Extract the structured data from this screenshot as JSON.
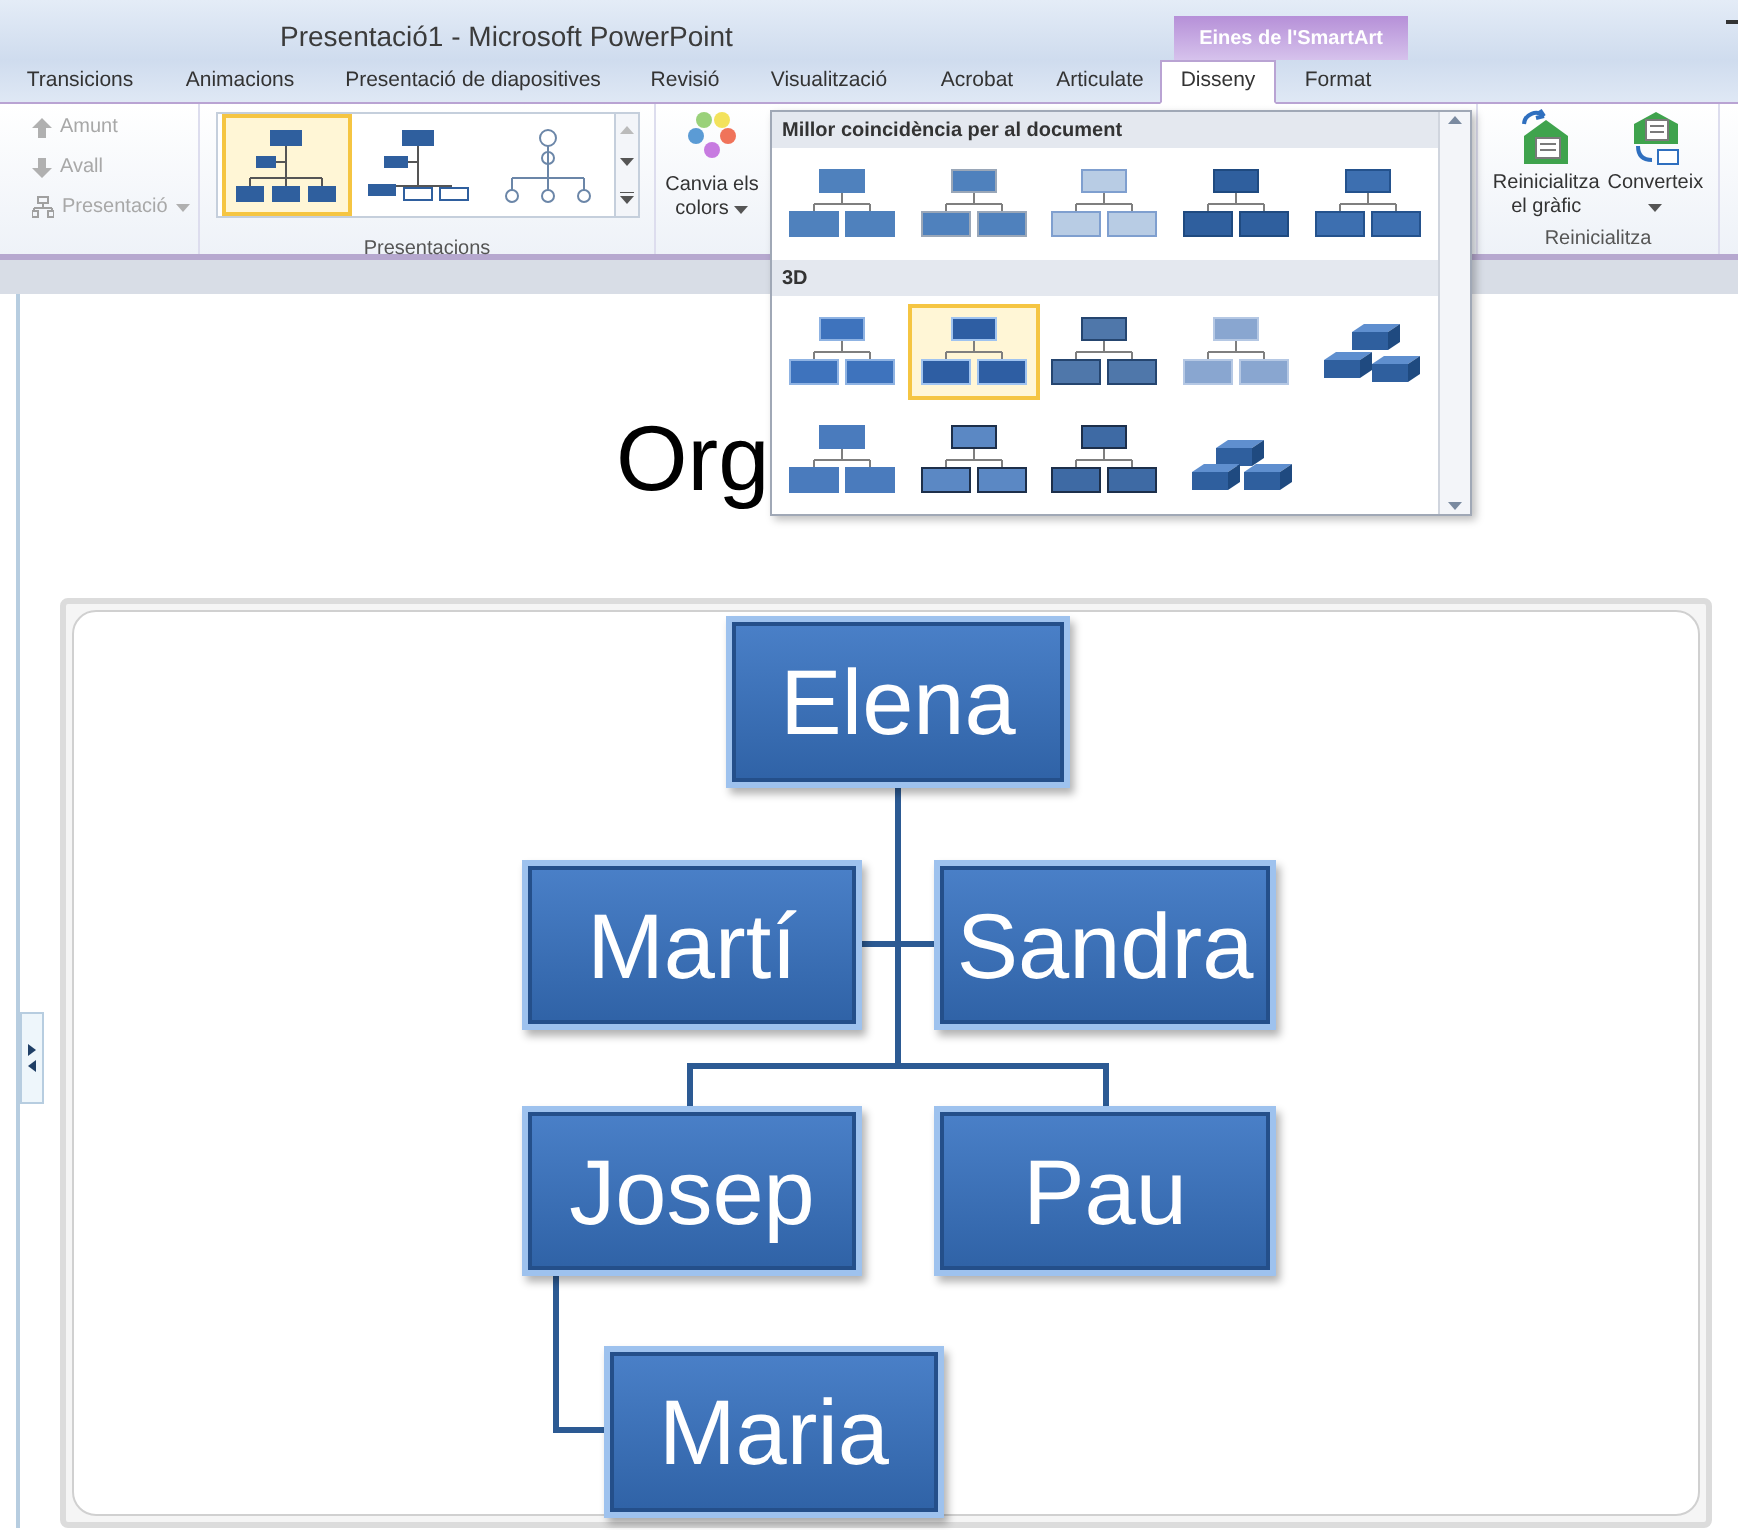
{
  "window": {
    "title": "Presentació1 - Microsoft PowerPoint",
    "context_header": "Eines de l'SmartArt"
  },
  "tabs": [
    {
      "label": "Transicions",
      "selected": false
    },
    {
      "label": "Animacions",
      "selected": false
    },
    {
      "label": "Presentació de diapositives",
      "selected": false
    },
    {
      "label": "Revisió",
      "selected": false
    },
    {
      "label": "Visualització",
      "selected": false
    },
    {
      "label": "Acrobat",
      "selected": false
    },
    {
      "label": "Articulate",
      "selected": false
    },
    {
      "label": "Disseny",
      "selected": true
    },
    {
      "label": "Format",
      "selected": false
    }
  ],
  "ribbon": {
    "shape_commands": [
      {
        "label": "Amunt",
        "disabled": true,
        "kind": "up"
      },
      {
        "label": "Avall",
        "disabled": true,
        "kind": "down"
      },
      {
        "label": "Presentació",
        "disabled": true,
        "kind": "layout"
      }
    ],
    "layouts": {
      "label": "Presentacions",
      "items": [
        {
          "kind": "org",
          "selected": true
        },
        {
          "kind": "hierarchy",
          "selected": false
        },
        {
          "kind": "circle",
          "selected": false
        }
      ]
    },
    "colors_button": {
      "line1": "Canvia els",
      "line2": "colors"
    },
    "reset_group": {
      "label": "Reinicialitza",
      "buttons": [
        {
          "line1": "Reinicialitza",
          "line2": "el gràfic",
          "kind": "reset"
        },
        {
          "line1": "Converteix",
          "kind": "convert"
        }
      ]
    }
  },
  "styles_gallery": {
    "sections": [
      {
        "heading": "Millor coincidència per al document",
        "items": [
          {
            "kind": "simple",
            "selected": false
          },
          {
            "kind": "shadow",
            "selected": false
          },
          {
            "kind": "light",
            "selected": false
          },
          {
            "kind": "dark",
            "selected": false
          },
          {
            "kind": "gradient",
            "selected": false
          }
        ]
      },
      {
        "heading": "3D",
        "items": [
          {
            "kind": "bevel",
            "selected": false
          },
          {
            "kind": "bevel-dark",
            "selected": true
          },
          {
            "kind": "outline",
            "selected": false
          },
          {
            "kind": "faded",
            "selected": false
          },
          {
            "kind": "blocks",
            "selected": false
          },
          {
            "kind": "flat",
            "selected": false
          },
          {
            "kind": "frame",
            "selected": false
          },
          {
            "kind": "frame-dark",
            "selected": false
          },
          {
            "kind": "bricks",
            "selected": false
          }
        ]
      }
    ]
  },
  "slide": {
    "title": "Org",
    "org_chart": [
      {
        "name": "Elena"
      },
      {
        "name": "Martí"
      },
      {
        "name": "Sandra"
      },
      {
        "name": "Josep"
      },
      {
        "name": "Pau"
      },
      {
        "name": "Maria"
      }
    ]
  }
}
